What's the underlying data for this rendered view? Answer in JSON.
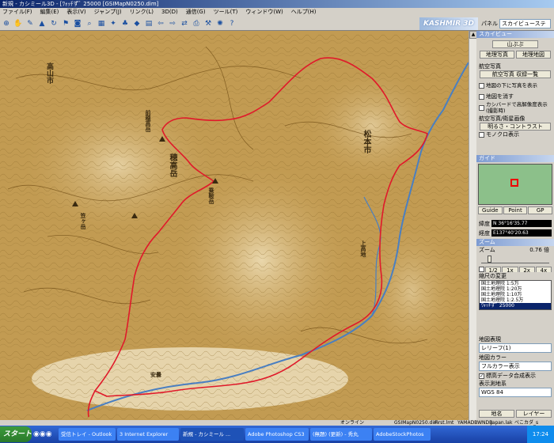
{
  "window": {
    "title": "新規 - カシミール3D - [ﾜｫｯﾁずﾞ 25000 [GSIMapN0250.dim]"
  },
  "menu": [
    "ファイル(F)",
    "編集(E)",
    "表示(V)",
    "ジャンプ(J)",
    "リンク(L)",
    "3D(D)",
    "通信(G)",
    "ツール(T)",
    "ウィンドウ(W)",
    "ヘルプ(H)"
  ],
  "toolbar": {
    "brand": "KASHMIR 3D",
    "panel_label": "パネル",
    "panel_select": "スカイビューステ"
  },
  "map": {
    "labels": [
      "高山市",
      "松本市",
      "穂高岳",
      "乗鞍岳",
      "笠ヶ岳",
      "前穂高岳",
      "安曇",
      "上高地"
    ]
  },
  "sidebar": {
    "skyview": {
      "header": "スカイビュー",
      "button": "山ぷぷ",
      "btn_photo": "地理写真",
      "btn_map": "地理地図"
    },
    "aerial": {
      "header": "航空写真",
      "btn_list": "航空写真 収録一覧",
      "checks": [
        {
          "label": "地図の下に写真を表示",
          "checked": false
        },
        {
          "label": "地図を消す",
          "checked": false
        },
        {
          "label": "カシバードで高解像度表示(撮影時)",
          "checked": false
        }
      ],
      "subheader": "航空写真/衛星画像",
      "btn_contrast": "明るさ・コントラスト",
      "mono": {
        "label": "モノクロ表示",
        "checked": false
      }
    },
    "guide": {
      "header": "ガイド",
      "tabs": [
        "Guide",
        "Point",
        "GP"
      ]
    },
    "coords": {
      "lat_label": "緯度",
      "lat": "N 36°16'35.77",
      "lon_label": "経度",
      "lon": "E137°40'20.63"
    },
    "zoom": {
      "header": "ズーム",
      "label": "ズーム",
      "value": "0.76 倍",
      "fraction": 0.1,
      "buttons": [
        "1/2",
        "1x",
        "2x",
        "4x"
      ]
    },
    "scale": {
      "header": "縮尺の変更",
      "items": [
        "国土地理院 1:5万",
        "国土地理院 1:20万",
        "国土地理院 1:10万",
        "国土地理院 1:2.5万",
        "ﾜｫｯﾁずﾞ 25000"
      ],
      "selected": 4
    },
    "display": {
      "header": "地図表現",
      "layer_select": "レリーフ(1)",
      "color_header": "地図カラー",
      "color_select": "フルカラー表示",
      "elevation": {
        "label": "標高データ合成表示",
        "checked": true
      },
      "datum_header": "表示測地系",
      "datum_select": "WGS 84"
    },
    "bottom_tabs": [
      "地名",
      "レイヤー"
    ]
  },
  "statusbar": {
    "items": [
      "オンライン",
      "GSIMapN0250.dim",
      "First.lmt",
      "YAMADBWNDB",
      "Japan.lak",
      "べこカダ_s"
    ]
  },
  "taskbar": {
    "start": "スタート",
    "tasks": [
      {
        "label": "受信トレイ - Outlook",
        "active": false
      },
      {
        "label": "3 Internet Explorer",
        "active": false
      },
      {
        "label": "新規 - カシミール ...",
        "active": true
      },
      {
        "label": "Adobe Photoshop CS3",
        "active": false
      },
      {
        "label": "(無題) (更新) - 秀丸",
        "active": false
      },
      {
        "label": "AdobeStockPhotos",
        "active": false
      }
    ],
    "clock": "17:24"
  }
}
